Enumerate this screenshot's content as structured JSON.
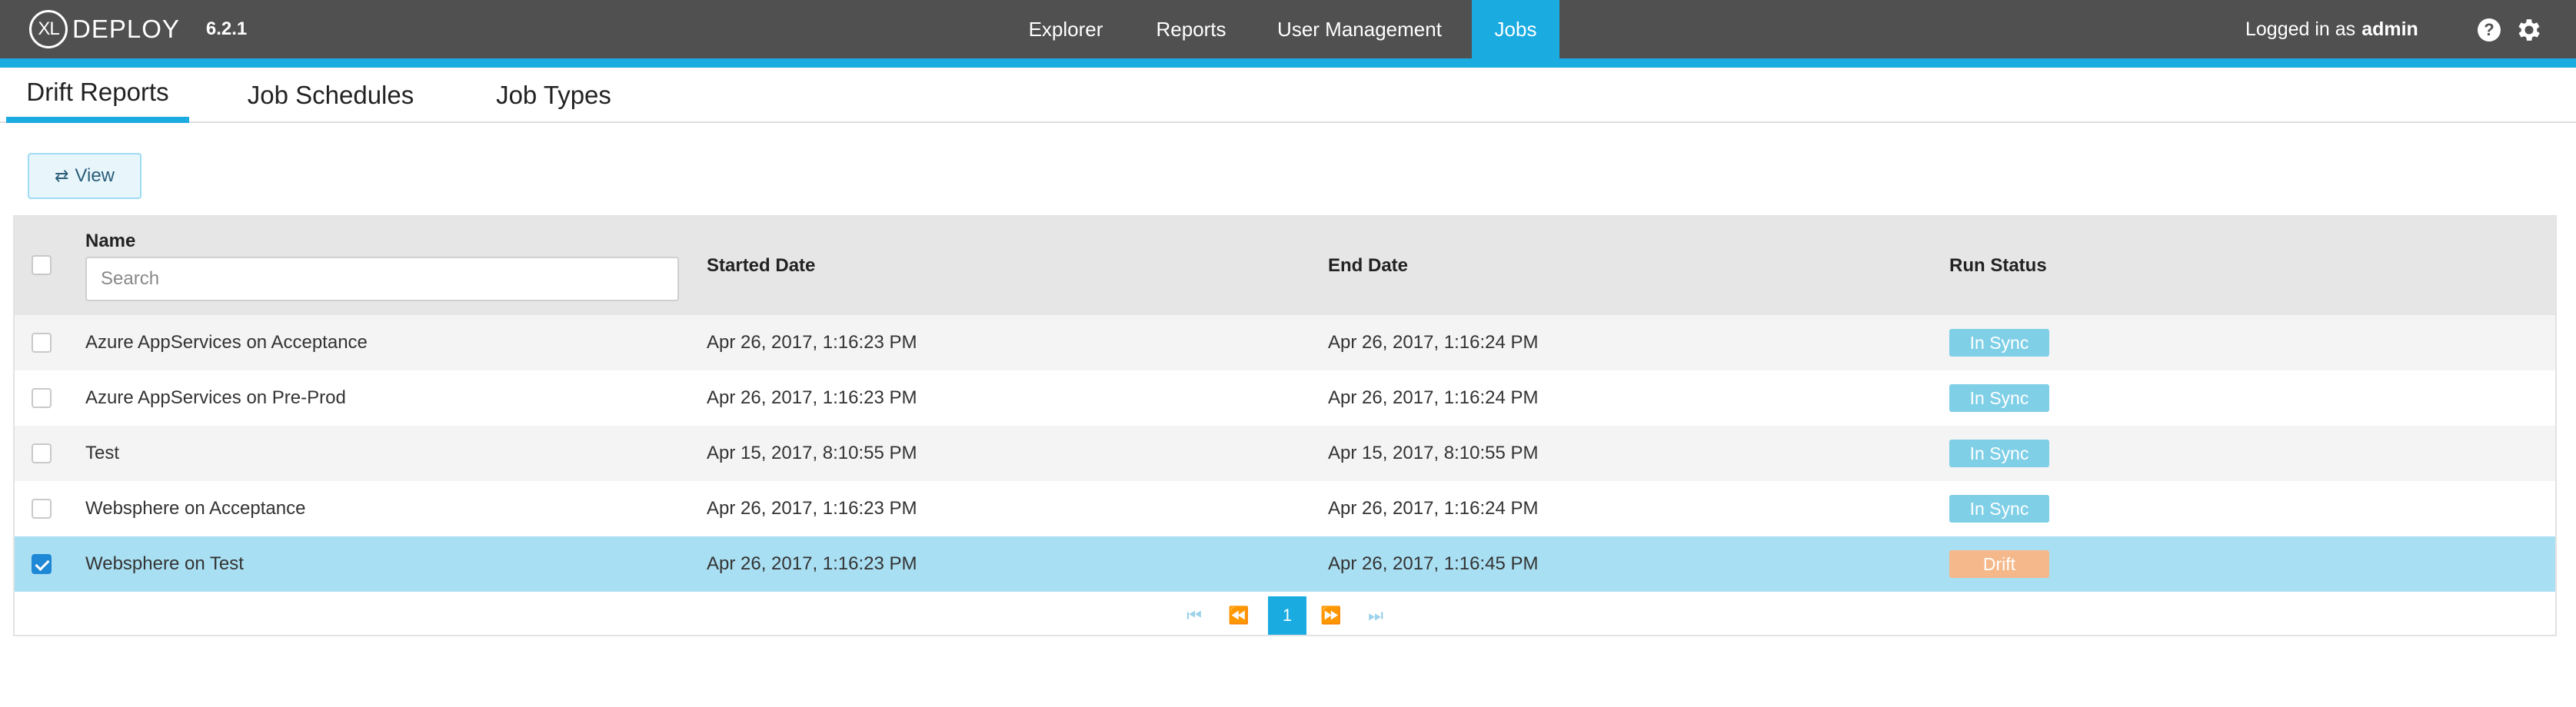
{
  "header": {
    "logo_mark": "XL",
    "product": "DEPLOY",
    "version": "6.2.1",
    "nav": [
      {
        "label": "Explorer",
        "active": false
      },
      {
        "label": "Reports",
        "active": false
      },
      {
        "label": "User Management",
        "active": false
      },
      {
        "label": "Jobs",
        "active": true
      }
    ],
    "logged_in_prefix": "Logged in as",
    "username": "admin",
    "help_symbol": "?",
    "icons": [
      "help-icon",
      "gear-icon"
    ]
  },
  "subtabs": [
    {
      "label": "Drift Reports",
      "active": true
    },
    {
      "label": "Job Schedules",
      "active": false
    },
    {
      "label": "Job Types",
      "active": false
    }
  ],
  "toolbar": {
    "view_label": "View",
    "view_icon": "swap-arrows-icon"
  },
  "table": {
    "columns": {
      "name": "Name",
      "started": "Started Date",
      "ended": "End Date",
      "status": "Run Status"
    },
    "search_placeholder": "Search",
    "rows": [
      {
        "name": "Azure AppServices on Acceptance",
        "started": "Apr 26, 2017, 1:16:23 PM",
        "ended": "Apr 26, 2017, 1:16:24 PM",
        "status": "In Sync",
        "checked": false
      },
      {
        "name": "Azure AppServices on Pre-Prod",
        "started": "Apr 26, 2017, 1:16:23 PM",
        "ended": "Apr 26, 2017, 1:16:24 PM",
        "status": "In Sync",
        "checked": false
      },
      {
        "name": "Test",
        "started": "Apr 15, 2017, 8:10:55 PM",
        "ended": "Apr 15, 2017, 8:10:55 PM",
        "status": "In Sync",
        "checked": false
      },
      {
        "name": "Websphere on Acceptance",
        "started": "Apr 26, 2017, 1:16:23 PM",
        "ended": "Apr 26, 2017, 1:16:24 PM",
        "status": "In Sync",
        "checked": false
      },
      {
        "name": "Websphere on Test",
        "started": "Apr 26, 2017, 1:16:23 PM",
        "ended": "Apr 26, 2017, 1:16:45 PM",
        "status": "Drift",
        "checked": true
      }
    ]
  },
  "pagination": {
    "current_page": "1"
  },
  "colors": {
    "accent": "#1aabe1",
    "topbar": "#505050",
    "in_sync": "#7fcfe6",
    "drift": "#f5b88a",
    "selected_row": "#a9dff2"
  }
}
